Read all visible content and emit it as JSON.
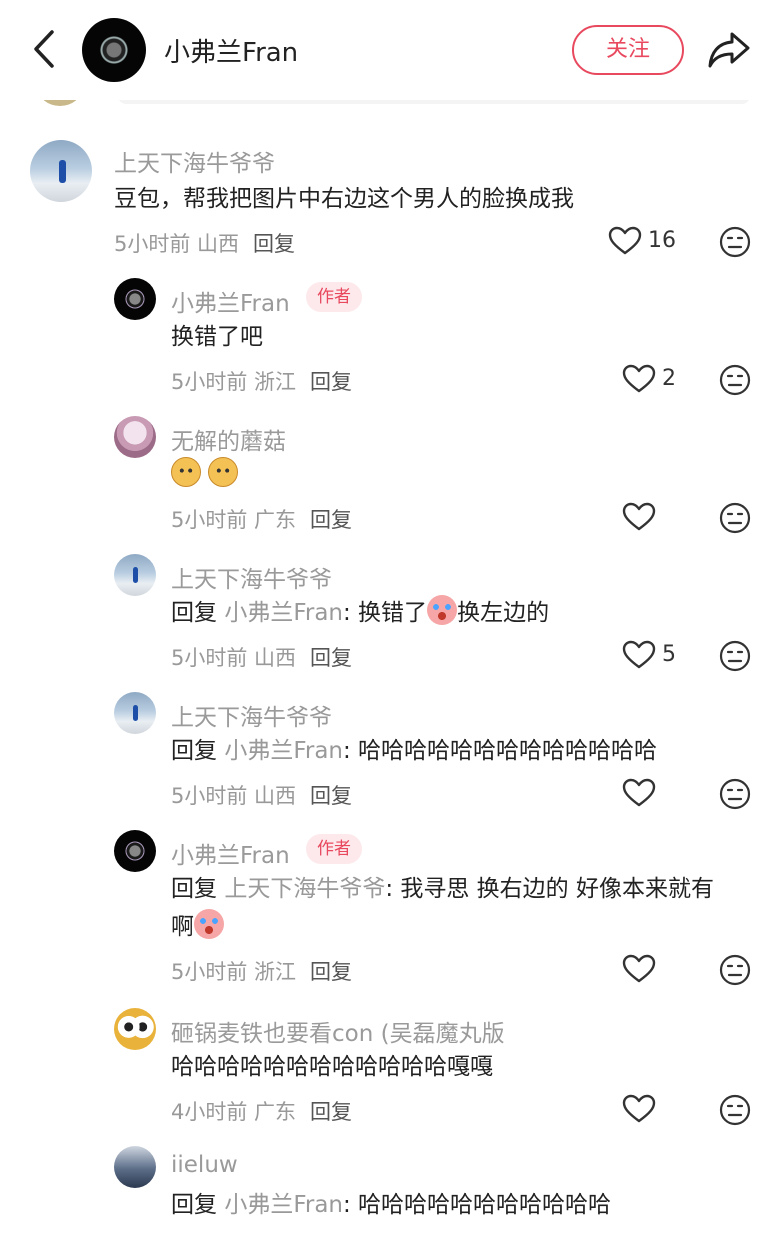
{
  "header": {
    "title": "小弗兰Fran",
    "follow_label": "关注"
  },
  "comments": [
    {
      "user": "上天下海牛爷爷",
      "text": "豆包，帮我把图片中右边这个男人的脸换成我",
      "time_loc": "5小时前 山西",
      "reply_label": "回复",
      "likes": "16",
      "avatar_icon": "skier-avatar"
    },
    {
      "user": "小弗兰Fran",
      "badge": "作者",
      "text": "换错了吧",
      "time_loc": "5小时前 浙江",
      "reply_label": "回复",
      "likes": "2",
      "avatar_icon": "fran-avatar"
    },
    {
      "user": "无解的蘑菇",
      "text_emoji": [
        "dog-face-emoji",
        "dog-face-emoji"
      ],
      "time_loc": "5小时前 广东",
      "reply_label": "回复",
      "avatar_icon": "mushroom-avatar"
    },
    {
      "user": "上天下海牛爷爷",
      "reply_prefix": "回复",
      "reply_to": "小弗兰Fran",
      "text_a": ": 换错了",
      "text_b": "换左边的",
      "text_emoji": "crying-face-emoji",
      "time_loc": "5小时前 山西",
      "reply_label": "回复",
      "likes": "5",
      "avatar_icon": "skier-avatar"
    },
    {
      "user": "上天下海牛爷爷",
      "reply_prefix": "回复",
      "reply_to": "小弗兰Fran",
      "text": ": 哈哈哈哈哈哈哈哈哈哈哈哈哈",
      "time_loc": "5小时前 山西",
      "reply_label": "回复",
      "avatar_icon": "skier-avatar"
    },
    {
      "user": "小弗兰Fran",
      "badge": "作者",
      "reply_prefix": "回复",
      "reply_to": "上天下海牛爷爷",
      "text": ": 我寻思 换右边的 好像本来就有",
      "text_line2": "啊",
      "text_emoji": "crying-face-emoji",
      "time_loc": "5小时前 浙江",
      "reply_label": "回复",
      "avatar_icon": "fran-avatar"
    },
    {
      "user": "砸锅麦铁也要看con (吴磊魔丸版",
      "text": "哈哈哈哈哈哈哈哈哈哈哈哈嘎嘎",
      "time_loc": "4小时前 广东",
      "reply_label": "回复",
      "avatar_icon": "duck-avatar"
    },
    {
      "user": "iieluw",
      "reply_prefix": "回复",
      "reply_to": "小弗兰Fran",
      "text": ": 哈哈哈哈哈哈哈哈哈哈哈",
      "avatar_icon": "person-avatar"
    }
  ],
  "colors": {
    "accent": "#e8495e",
    "badge_bg": "#fde9ec",
    "muted_text": "#999999",
    "body_text": "#222222"
  },
  "icons": {
    "back": "chevron-left-icon",
    "share": "share-arrow-icon",
    "like": "heart-outline-icon",
    "dislike": "neutral-face-icon"
  }
}
